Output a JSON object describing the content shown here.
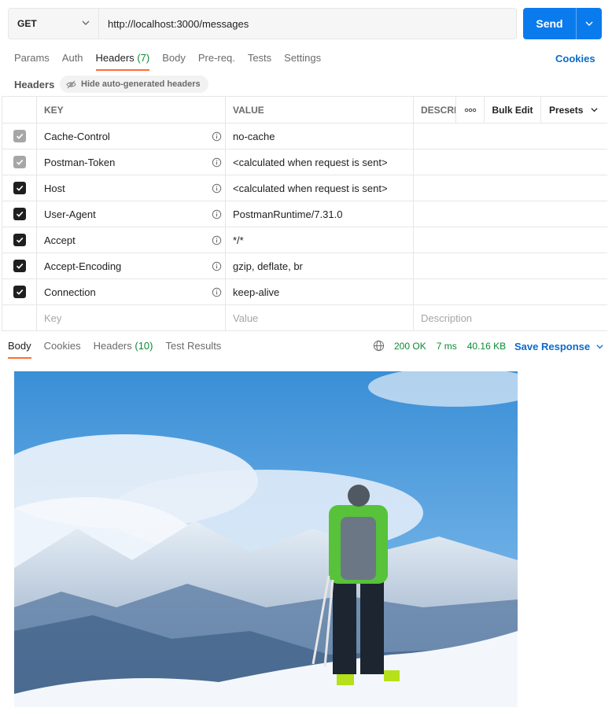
{
  "request": {
    "method": "GET",
    "url": "http://localhost:3000/messages",
    "send_label": "Send"
  },
  "request_tabs": [
    {
      "label": "Params"
    },
    {
      "label": "Auth"
    },
    {
      "label": "Headers",
      "count": "(7)"
    },
    {
      "label": "Body"
    },
    {
      "label": "Pre-req."
    },
    {
      "label": "Tests"
    },
    {
      "label": "Settings"
    }
  ],
  "cookies_label": "Cookies",
  "headers_section": {
    "title": "Headers",
    "hide_label": "Hide auto-generated headers"
  },
  "table": {
    "columns": {
      "key": "KEY",
      "value": "VALUE",
      "description": "DESCRI",
      "bulk_edit": "Bulk Edit",
      "presets": "Presets"
    },
    "rows": [
      {
        "key": "Cache-Control",
        "value": "no-cache",
        "checked": "disabled"
      },
      {
        "key": "Postman-Token",
        "value": "<calculated when request is sent>",
        "checked": "disabled"
      },
      {
        "key": "Host",
        "value": "<calculated when request is sent>",
        "checked": "on"
      },
      {
        "key": "User-Agent",
        "value": "PostmanRuntime/7.31.0",
        "checked": "on"
      },
      {
        "key": "Accept",
        "value": "*/*",
        "checked": "on"
      },
      {
        "key": "Accept-Encoding",
        "value": "gzip, deflate, br",
        "checked": "on"
      },
      {
        "key": "Connection",
        "value": "keep-alive",
        "checked": "on"
      }
    ],
    "placeholders": {
      "key": "Key",
      "value": "Value",
      "description": "Description"
    }
  },
  "response": {
    "tabs": [
      {
        "label": "Body"
      },
      {
        "label": "Cookies"
      },
      {
        "label": "Headers",
        "count": "(10)"
      },
      {
        "label": "Test Results"
      }
    ],
    "status": "200 OK",
    "time": "7 ms",
    "size": "40.16 KB",
    "save_label": "Save Response"
  },
  "colors": {
    "accent": "#ff6c37",
    "primary": "#097bed",
    "link": "#0b6bcb",
    "success": "#0a8a36"
  }
}
